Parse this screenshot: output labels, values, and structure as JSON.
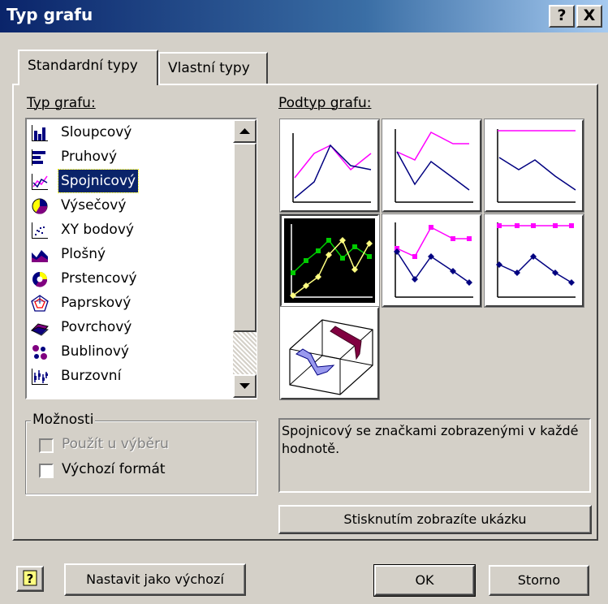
{
  "window": {
    "title": "Typ grafu",
    "help_button": "?",
    "close_button": "X"
  },
  "tabs": [
    {
      "label": "Standardní typy",
      "active": true
    },
    {
      "label": "Vlastní typy",
      "active": false
    }
  ],
  "chart_type": {
    "label": "Typ grafu:",
    "items": [
      {
        "label": "Sloupcový",
        "icon": "column-chart-icon"
      },
      {
        "label": "Pruhový",
        "icon": "bar-chart-icon"
      },
      {
        "label": "Spojnicový",
        "icon": "line-chart-icon",
        "selected": true
      },
      {
        "label": "Výsečový",
        "icon": "pie-chart-icon"
      },
      {
        "label": "XY bodový",
        "icon": "scatter-chart-icon"
      },
      {
        "label": "Plošný",
        "icon": "area-chart-icon"
      },
      {
        "label": "Prstencový",
        "icon": "doughnut-chart-icon"
      },
      {
        "label": "Paprskový",
        "icon": "radar-chart-icon"
      },
      {
        "label": "Povrchový",
        "icon": "surface-chart-icon"
      },
      {
        "label": "Bublinový",
        "icon": "bubble-chart-icon"
      },
      {
        "label": "Burzovní",
        "icon": "stock-chart-icon"
      }
    ]
  },
  "chart_subtype": {
    "label": "Podtyp grafu:",
    "selected_index": 3,
    "description": "Spojnicový se značkami zobrazenými v každé hodnotě."
  },
  "options": {
    "legend": "Možnosti",
    "apply_to_selection": "Použít u výběru",
    "default_format": "Výchozí formát"
  },
  "buttons": {
    "preview": "Stisknutím zobrazíte ukázku",
    "set_default": "Nastavit jako výchozí",
    "ok": "OK",
    "cancel": "Storno"
  },
  "colors": {
    "title_bar": "#0a246a",
    "selection": "#0a246a",
    "series_magenta": "#ff00ff",
    "series_navy": "#000080"
  }
}
